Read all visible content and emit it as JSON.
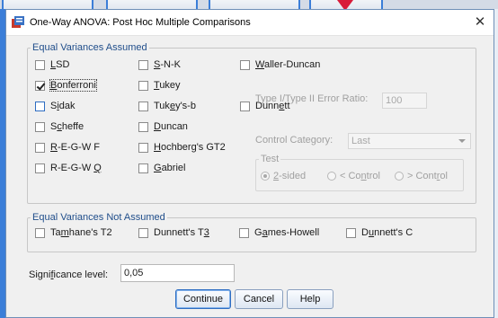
{
  "window": {
    "title": "One-Way ANOVA: Post Hoc Multiple Comparisons",
    "close_glyph": "✕"
  },
  "equal_variances": {
    "legend": "Equal Variances Assumed",
    "options": [
      {
        "pre": "",
        "u": "L",
        "post": "SD",
        "checked": false
      },
      {
        "pre": "",
        "u": "B",
        "post": "onferroni",
        "checked": true
      },
      {
        "pre": "S",
        "u": "i",
        "post": "dak",
        "checked": false
      },
      {
        "pre": "S",
        "u": "c",
        "post": "heffe",
        "checked": false
      },
      {
        "pre": "",
        "u": "R",
        "post": "-E-G-W F",
        "checked": false
      },
      {
        "pre": "R-E-G-W ",
        "u": "Q",
        "post": "",
        "checked": false
      },
      {
        "pre": "",
        "u": "S",
        "post": "-N-K",
        "checked": false
      },
      {
        "pre": "",
        "u": "T",
        "post": "ukey",
        "checked": false
      },
      {
        "pre": "Tuk",
        "u": "e",
        "post": "y's-b",
        "checked": false
      },
      {
        "pre": "",
        "u": "D",
        "post": "uncan",
        "checked": false
      },
      {
        "pre": "",
        "u": "H",
        "post": "ochberg's GT2",
        "checked": false
      },
      {
        "pre": "",
        "u": "G",
        "post": "abriel",
        "checked": false
      },
      {
        "pre": "",
        "u": "W",
        "post": "aller-Duncan",
        "checked": false
      },
      {
        "pre": "Dunn",
        "u": "e",
        "post": "tt",
        "checked": false
      }
    ],
    "error_ratio_label": "Type I/Type II Error Ratio:",
    "error_ratio_value": "100",
    "control_category_label": "Control Category",
    "control_category_value": "Last",
    "test_legend": "Test",
    "test_options": [
      {
        "pre": "",
        "u": "2",
        "post": "-sided",
        "selected": true
      },
      {
        "pre": "< Co",
        "u": "n",
        "post": "trol",
        "selected": false
      },
      {
        "pre": "> Cont",
        "u": "r",
        "post": "ol",
        "selected": false
      }
    ]
  },
  "unequal_variances": {
    "legend": "Equal Variances Not Assumed",
    "options": [
      {
        "pre": "Ta",
        "u": "m",
        "post": "hane's T2",
        "checked": false
      },
      {
        "pre": "Dunnett's T",
        "u": "3",
        "post": "",
        "checked": false
      },
      {
        "pre": "G",
        "u": "a",
        "post": "mes-Howell",
        "checked": false
      },
      {
        "pre": "D",
        "u": "u",
        "post": "nnett's C",
        "checked": false
      }
    ]
  },
  "significance": {
    "label": "Signi",
    "label_u": "f",
    "label_post": "icance level:",
    "value": "0,05"
  },
  "buttons": {
    "continue": "Continue",
    "cancel": "Cancel",
    "help": "Help"
  },
  "colors": {
    "accent": "#3b7ed8",
    "legend": "#1f4d8a",
    "alert_arrow": "#d81b3a"
  }
}
